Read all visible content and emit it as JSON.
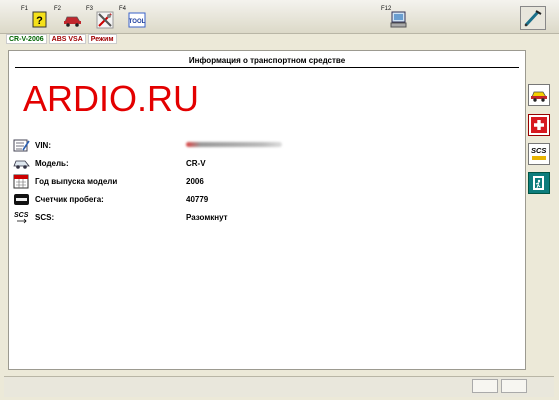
{
  "toolbar": {
    "f1": "F1",
    "f2": "F2",
    "f3": "F3",
    "f4": "F4",
    "f12": "F12",
    "icons": [
      "help-icon",
      "vehicle-icon",
      "tools-icon",
      "tool-icon",
      "computer-icon",
      "diagnostic-pen-icon"
    ]
  },
  "tabs": {
    "model": "CR-V-2006",
    "abs": "ABS VSA",
    "mode": "Режим"
  },
  "panel": {
    "title": "Информация о транспортном средстве",
    "watermark": "ARDIO.RU"
  },
  "info": {
    "vin_label": "VIN:",
    "model_label": "Модель:",
    "model_value": "CR-V",
    "year_label": "Год выпуска модели",
    "year_value": "2006",
    "odo_label": "Счетчик пробега:",
    "odo_value": "40779",
    "scs_label": "SCS:",
    "scs_value": "Разомкнут"
  },
  "side_icons": [
    "car-info-icon",
    "first-aid-icon",
    "scs-icon",
    "exit-icon"
  ],
  "colors": {
    "watermark": "#e30000",
    "accent": "#0c7c7c"
  }
}
